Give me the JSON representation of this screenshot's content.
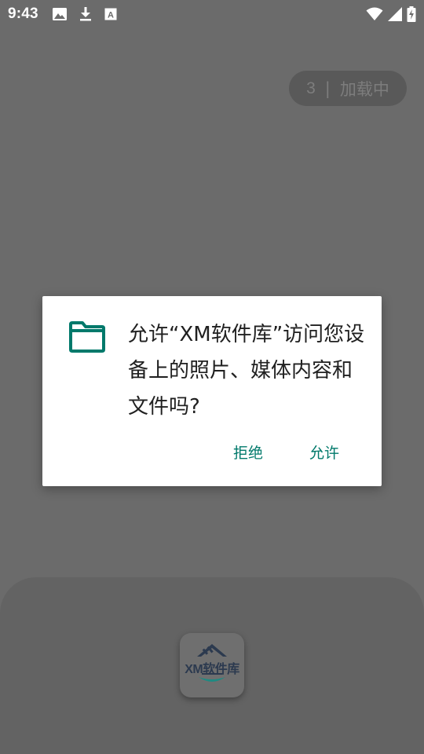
{
  "status_bar": {
    "time": "9:43",
    "left_icons": [
      "image-icon",
      "download-icon",
      "text-a-icon"
    ],
    "right_icons": [
      "wifi-icon",
      "signal-icon",
      "battery-charging-icon"
    ]
  },
  "loading": {
    "count": "3",
    "separator": "|",
    "label": "加载中"
  },
  "dialog": {
    "icon": "folder-icon",
    "message": "允许“XM软件库”访问您设备上的照片、媒体内容和文件吗?",
    "deny_label": "拒绝",
    "allow_label": "允许",
    "accent_color": "#00796b"
  },
  "app_icon": {
    "logo_text": "XM软件库"
  }
}
